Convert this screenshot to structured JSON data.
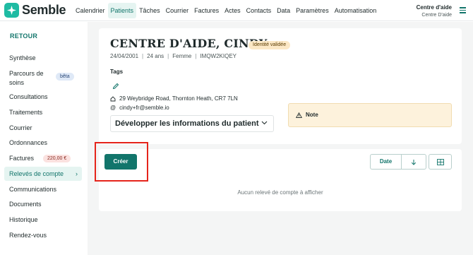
{
  "app": {
    "brand": "Semble"
  },
  "nav": [
    "Calendrier",
    "Patients",
    "Tâches",
    "Courrier",
    "Factures",
    "Actes",
    "Contacts",
    "Data",
    "Paramètres",
    "Automatisation"
  ],
  "nav_active": "Patients",
  "account": {
    "name": "Centre d'aide",
    "subtitle": "Centre D'aide"
  },
  "sidebar": {
    "back_label": "RETOUR",
    "items": [
      {
        "label": "Synthèse"
      },
      {
        "label": "Parcours de soins",
        "badge": "bêta"
      },
      {
        "label": "Consultations"
      },
      {
        "label": "Traitements"
      },
      {
        "label": "Courrier"
      },
      {
        "label": "Ordonnances"
      },
      {
        "label": "Factures",
        "badge": "220,00 €"
      },
      {
        "label": "Relevés de compte",
        "active": true
      },
      {
        "label": "Communications"
      },
      {
        "label": "Documents"
      },
      {
        "label": "Historique"
      },
      {
        "label": "Rendez-vous"
      }
    ]
  },
  "patient": {
    "name": "CENTRE D'AIDE, CINDY",
    "id_badge": "Identité validée",
    "dob": "24/04/2001",
    "age": "24 ans",
    "sex": "Femme",
    "ref": "IMQW2KIQEY",
    "tags_label": "Tags",
    "address": "29 Weybridge Road, Thornton Heath, CR7 7LN",
    "email": "cindy+fr@semble.io",
    "expand_label": "Développer les informations du patient",
    "note_label": "Note"
  },
  "statements": {
    "create_label": "Créer",
    "sort_label": "Date",
    "empty_message": "Aucun relevé de compte à afficher"
  },
  "colors": {
    "accent": "#12756b",
    "brand": "#1fbba3",
    "highlight": "#e5241b",
    "note_bg": "#fdf2dc"
  }
}
